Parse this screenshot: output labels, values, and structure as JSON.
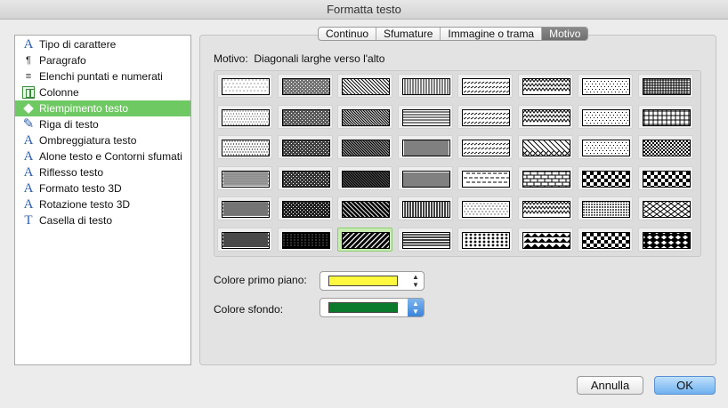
{
  "window": {
    "title": "Formatta testo"
  },
  "sidebar": {
    "items": [
      {
        "label": "Tipo di carattere",
        "icon": "font-icon",
        "glyph": "A"
      },
      {
        "label": "Paragrafo",
        "icon": "paragraph-icon",
        "glyph": "¶"
      },
      {
        "label": "Elenchi puntati e numerati",
        "icon": "bullet-list-icon",
        "glyph": "≡"
      },
      {
        "label": "Colonne",
        "icon": "columns-icon",
        "glyph": ""
      },
      {
        "label": "Riempimento testo",
        "icon": "fill-bucket-icon",
        "glyph": "◆"
      },
      {
        "label": "Riga di testo",
        "icon": "pencil-icon",
        "glyph": "✎"
      },
      {
        "label": "Ombreggiatura testo",
        "icon": "text-shadow-icon",
        "glyph": "A"
      },
      {
        "label": "Alone testo e Contorni sfumati",
        "icon": "text-glow-icon",
        "glyph": "A"
      },
      {
        "label": "Riflesso testo",
        "icon": "text-reflection-icon",
        "glyph": "A"
      },
      {
        "label": "Formato testo 3D",
        "icon": "text-3d-format-icon",
        "glyph": "A"
      },
      {
        "label": "Rotazione testo 3D",
        "icon": "text-3d-rotation-icon",
        "glyph": "A"
      },
      {
        "label": "Casella di testo",
        "icon": "text-box-icon",
        "glyph": "T"
      }
    ],
    "selected": "Riempimento testo"
  },
  "tabs": [
    "Continuo",
    "Sfumature",
    "Immagine o trama",
    "Motivo"
  ],
  "active_tab": "Motivo",
  "pattern": {
    "label": "Motivo:",
    "name": "Diagonali larghe verso l'alto",
    "selected_index": 42
  },
  "patterns": [
    "dots-sparse",
    "dark-upward-diagonal",
    "wide-downward-diagonal",
    "vertical-lines",
    "small-checker-diag",
    "zigzag",
    "small-confetti",
    "small-grid",
    "dots-light",
    "dark-dots",
    "dark-downward-diagonal",
    "horizontal-lines",
    "dashed-diag",
    "wave",
    "dotted-grid",
    "large-grid",
    "dots-medium",
    "dense-dark",
    "diagonal-medium",
    "dense-vertical",
    "dashed-horizontal",
    "diagonal-brick",
    "sphere-pattern",
    "small-checker",
    "dots-dense",
    "darker-dots",
    "dark-diagonal",
    "dense-horizontal",
    "horizontal-brick",
    "diagonal-brick-2",
    "weave",
    "large-checker",
    "dots-heavy",
    "very-dark",
    "wide-diagonal",
    "dark-vertical",
    "sparse-dots-2",
    "trellis",
    "outlined-diamond",
    "diamond-grid",
    "dots-darkest",
    "black",
    "wide-upward-diagonal",
    "dark-horizontal",
    "large-confetti",
    "shingle",
    "zigzag-solid",
    "solid-diamond"
  ],
  "foreground": {
    "label": "Colore primo piano:",
    "color": "#fef83f"
  },
  "background": {
    "label": "Colore sfondo:",
    "color": "#0a7a2c"
  },
  "buttons": {
    "cancel": "Annulla",
    "ok": "OK"
  }
}
